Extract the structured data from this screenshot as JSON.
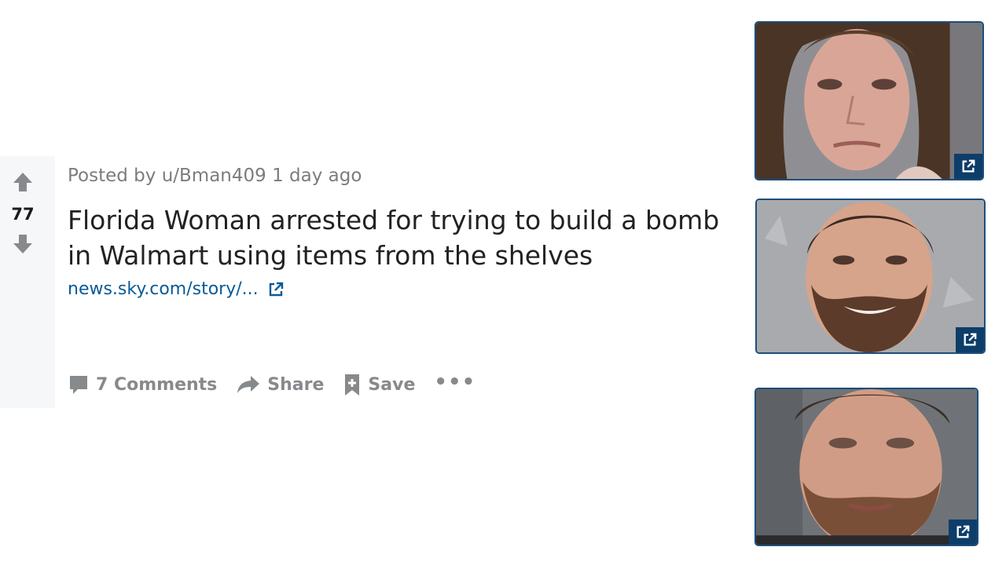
{
  "post": {
    "score": "77",
    "posted_by": "Posted by u/Bman409 1 day ago",
    "title": "Florida Woman arrested for trying to build a bomb in Walmart using items from the shelves",
    "link_text": "news.sky.com/story/...",
    "actions": {
      "comments_label": "7 Comments",
      "share_label": "Share",
      "save_label": "Save",
      "more_label": "•••"
    }
  },
  "icons": {
    "upvote": "upvote-arrow-icon",
    "downvote": "downvote-arrow-icon",
    "external_link": "external-link-icon",
    "comment": "comment-bubble-icon",
    "share": "share-arrow-icon",
    "save": "bookmark-plus-icon"
  },
  "thumbnails": [
    {
      "subject": "woman mugshot"
    },
    {
      "subject": "bearded man smiling mugshot"
    },
    {
      "subject": "bearded man mugshot"
    }
  ],
  "colors": {
    "link": "#0a5a96",
    "meta_text": "#7c7c7c",
    "action_text": "#878a8c",
    "thumb_border": "#1d4d7a",
    "badge_bg": "#0d3d69",
    "vote_rail_bg": "#f6f7f8"
  }
}
